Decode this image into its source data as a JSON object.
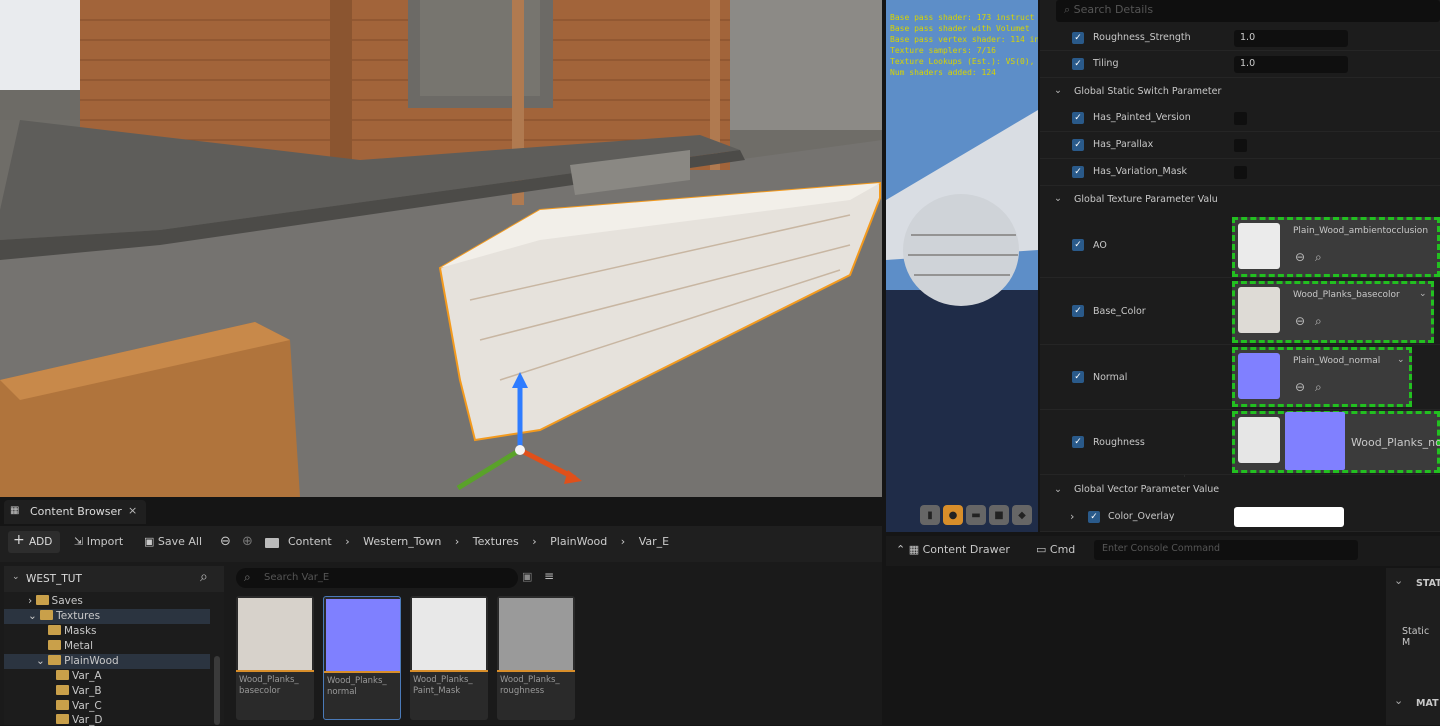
{
  "viewport": {
    "colors": {
      "wall": "#a2643a",
      "deck": "#5e5d5a",
      "ground": "#6f6d68",
      "bench": "#e6e2dc",
      "selection": "#f39a1e"
    }
  },
  "preview": {
    "shader_stats": [
      "Base pass shader: 173 instruct",
      "Base pass shader with Volumet",
      "Base pass vertex shader: 114 in",
      "Texture samplers: 7/16",
      "Texture Lookups (Est.): VS(0), F",
      "Num shaders added: 124"
    ]
  },
  "details": {
    "search_placeholder": "Search Details",
    "rows_top": [
      {
        "label": "Roughness_Strength",
        "value": "1.0"
      },
      {
        "label": "Tiling",
        "value": "1.0"
      }
    ],
    "static_switch_header": "Global Static Switch Parameter",
    "static_switches": [
      {
        "label": "Has_Painted_Version"
      },
      {
        "label": "Has_Parallax"
      },
      {
        "label": "Has_Variation_Mask"
      }
    ],
    "texture_header": "Global Texture Parameter Valu",
    "textures": [
      {
        "label": "AO",
        "asset": "Plain_Wood_ambientocclusion"
      },
      {
        "label": "Base_Color",
        "asset": "Wood_Planks_basecolor"
      },
      {
        "label": "Normal",
        "asset": "Plain_Wood_normal"
      },
      {
        "label": "Roughness",
        "asset": "Wood_Planks_no"
      }
    ],
    "vector_header": "Global Vector Parameter Value",
    "vector_row": {
      "label": "Color_Overlay"
    }
  },
  "statusbar": {
    "content_drawer": "Content Drawer",
    "cmd": "Cmd",
    "console_placeholder": "Enter Console Command"
  },
  "right_fragment": {
    "header1": "STAT",
    "label": "Static M",
    "header2": "MAT"
  },
  "content_browser": {
    "tab_label": "Content Browser",
    "add_label": "ADD",
    "import_label": "Import",
    "save_all_label": "Save All",
    "breadcrumb": [
      "Content",
      "Western_Town",
      "Textures",
      "PlainWood",
      "Var_E"
    ],
    "project": "WEST_TUT",
    "search_placeholder": "Search Var_E",
    "tree": [
      "Saves",
      "Textures",
      "Masks",
      "Metal",
      "PlainWood",
      "Var_A",
      "Var_B",
      "Var_C",
      "Var_D"
    ],
    "assets": [
      {
        "name": "Wood_Planks_\nbasecolor",
        "color": "#d7d2cb"
      },
      {
        "name": "Wood_Planks_\nnormal",
        "color": "#7f80ff"
      },
      {
        "name": "Wood_Planks_\nPaint_Mask",
        "color": "#e8e8e8"
      },
      {
        "name": "Wood_Planks_\nroughness",
        "color": "#9a9a9a"
      }
    ]
  }
}
